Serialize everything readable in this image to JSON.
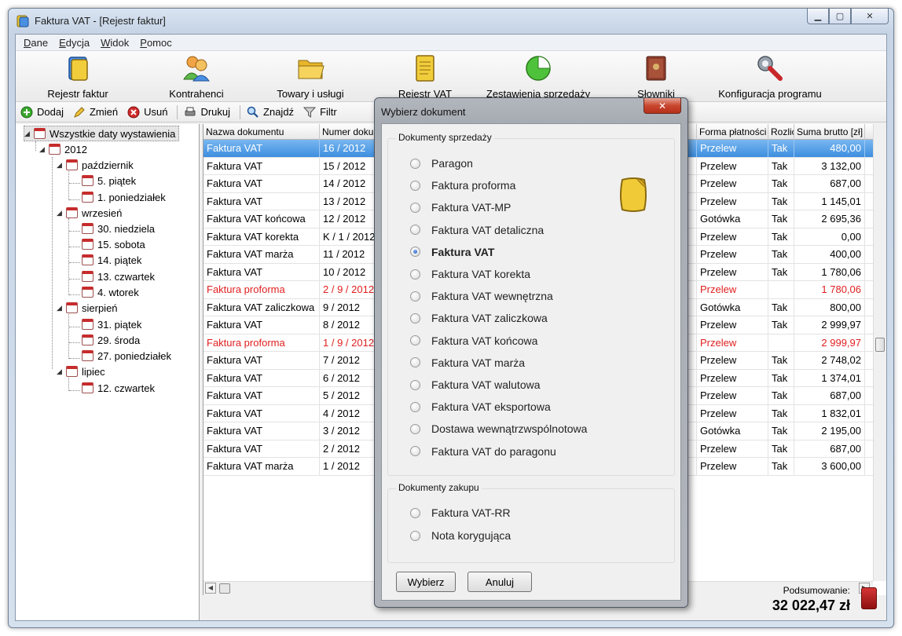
{
  "window": {
    "title": "Faktura VAT - [Rejestr faktur]"
  },
  "menu": [
    "Dane",
    "Edycja",
    "Widok",
    "Pomoc"
  ],
  "ribbon": [
    {
      "label": "Rejestr faktur",
      "icon": "invoice-register-icon"
    },
    {
      "label": "Kontrahenci",
      "icon": "contractors-icon"
    },
    {
      "label": "Towary i usługi",
      "icon": "folder-icon"
    },
    {
      "label": "Rejestr VAT",
      "icon": "vat-register-icon"
    },
    {
      "label": "Zestawienia sprzedaży",
      "icon": "pie-chart-icon"
    },
    {
      "label": "Słowniki",
      "icon": "book-icon"
    },
    {
      "label": "Konfiguracja programu",
      "icon": "wrench-icon"
    }
  ],
  "toolbar": {
    "add": "Dodaj",
    "edit": "Zmień",
    "delete": "Usuń",
    "print": "Drukuj",
    "find": "Znajdź",
    "filter": "Filtr"
  },
  "tree": {
    "root": "Wszystkie daty wystawienia",
    "year": "2012",
    "months": [
      {
        "name": "październik",
        "days": [
          "5. piątek",
          "1. poniedziałek"
        ]
      },
      {
        "name": "wrzesień",
        "days": [
          "30. niedziela",
          "15. sobota",
          "14. piątek",
          "13. czwartek",
          "4. wtorek"
        ]
      },
      {
        "name": "sierpień",
        "days": [
          "31. piątek",
          "29. środa",
          "27. poniedziałek"
        ]
      },
      {
        "name": "lipiec",
        "days": [
          "12. czwartek"
        ]
      }
    ]
  },
  "grid": {
    "columns": [
      "Nazwa dokumentu",
      "Numer dokum",
      "",
      "Forma płatności",
      "Rozlic",
      "Suma brutto [zł]"
    ],
    "rows": [
      {
        "name": "Faktura VAT",
        "number": "16 / 2012",
        "payment": "Przelew",
        "settled": "Tak",
        "total": "480,00",
        "state": "selected"
      },
      {
        "name": "Faktura VAT",
        "number": "15 / 2012",
        "payment": "Przelew",
        "settled": "Tak",
        "total": "3 132,00",
        "state": ""
      },
      {
        "name": "Faktura VAT",
        "number": "14 / 2012",
        "payment": "Przelew",
        "settled": "Tak",
        "total": "687,00",
        "state": ""
      },
      {
        "name": "Faktura VAT",
        "number": "13 / 2012",
        "payment": "Przelew",
        "settled": "Tak",
        "total": "1 145,01",
        "state": ""
      },
      {
        "name": "Faktura VAT końcowa",
        "number": "12 / 2012",
        "payment": "Gotówka",
        "settled": "Tak",
        "total": "2 695,36",
        "state": ""
      },
      {
        "name": "Faktura VAT korekta",
        "number": "K / 1 / 2012",
        "payment": "Przelew",
        "settled": "Tak",
        "total": "0,00",
        "state": ""
      },
      {
        "name": "Faktura VAT marża",
        "number": "11 / 2012",
        "payment": "Przelew",
        "settled": "Tak",
        "total": "400,00",
        "state": ""
      },
      {
        "name": "Faktura VAT",
        "number": "10 / 2012",
        "payment": "Przelew",
        "settled": "Tak",
        "total": "1 780,06",
        "state": ""
      },
      {
        "name": "Faktura proforma",
        "number": "2 / 9 / 2012",
        "payment": "Przelew",
        "settled": "",
        "total": "1 780,06",
        "state": "red"
      },
      {
        "name": "Faktura VAT zaliczkowa",
        "number": "9 / 2012",
        "payment": "Gotówka",
        "settled": "Tak",
        "total": "800,00",
        "state": ""
      },
      {
        "name": "Faktura VAT",
        "number": "8 / 2012",
        "payment": "Przelew",
        "settled": "Tak",
        "total": "2 999,97",
        "state": ""
      },
      {
        "name": "Faktura proforma",
        "number": "1 / 9 / 2012",
        "payment": "Przelew",
        "settled": "",
        "total": "2 999,97",
        "state": "red"
      },
      {
        "name": "Faktura VAT",
        "number": "7 / 2012",
        "payment": "Przelew",
        "settled": "Tak",
        "total": "2 748,02",
        "state": ""
      },
      {
        "name": "Faktura VAT",
        "number": "6 / 2012",
        "payment": "Przelew",
        "settled": "Tak",
        "total": "1 374,01",
        "state": ""
      },
      {
        "name": "Faktura VAT",
        "number": "5 / 2012",
        "payment": "Przelew",
        "settled": "Tak",
        "total": "687,00",
        "state": ""
      },
      {
        "name": "Faktura VAT",
        "number": "4 / 2012",
        "payment": "Przelew",
        "settled": "Tak",
        "total": "1 832,01",
        "state": ""
      },
      {
        "name": "Faktura VAT",
        "number": "3 / 2012",
        "payment": "Gotówka",
        "settled": "Tak",
        "total": "2 195,00",
        "state": ""
      },
      {
        "name": "Faktura VAT",
        "number": "2 / 2012",
        "payment": "Przelew",
        "settled": "Tak",
        "total": "687,00",
        "state": ""
      },
      {
        "name": "Faktura VAT marża",
        "number": "1 / 2012",
        "payment": "Przelew",
        "settled": "Tak",
        "total": "3 600,00",
        "state": ""
      }
    ]
  },
  "summary": {
    "label": "Podsumowanie:",
    "value": "32 022,47  zł"
  },
  "dialog": {
    "title": "Wybierz dokument",
    "sales_group": "Dokumenty sprzedaży",
    "sales_options": [
      "Paragon",
      "Faktura proforma",
      "Faktura VAT-MP",
      "Faktura VAT detaliczna",
      "Faktura VAT",
      "Faktura VAT korekta",
      "Faktura VAT wewnętrzna",
      "Faktura VAT zaliczkowa",
      "Faktura VAT końcowa",
      "Faktura VAT marża",
      "Faktura VAT walutowa",
      "Faktura VAT eksportowa",
      "Dostawa wewnątrzwspólnotowa",
      "Faktura VAT do paragonu"
    ],
    "selected": "Faktura VAT",
    "purchase_group": "Dokumenty zakupu",
    "purchase_options": [
      "Faktura VAT-RR",
      "Nota korygująca"
    ],
    "ok": "Wybierz",
    "cancel": "Anuluj"
  },
  "colors": {
    "selection": "#3d8ee0",
    "proforma": "#e02020",
    "close": "#c9462e"
  }
}
